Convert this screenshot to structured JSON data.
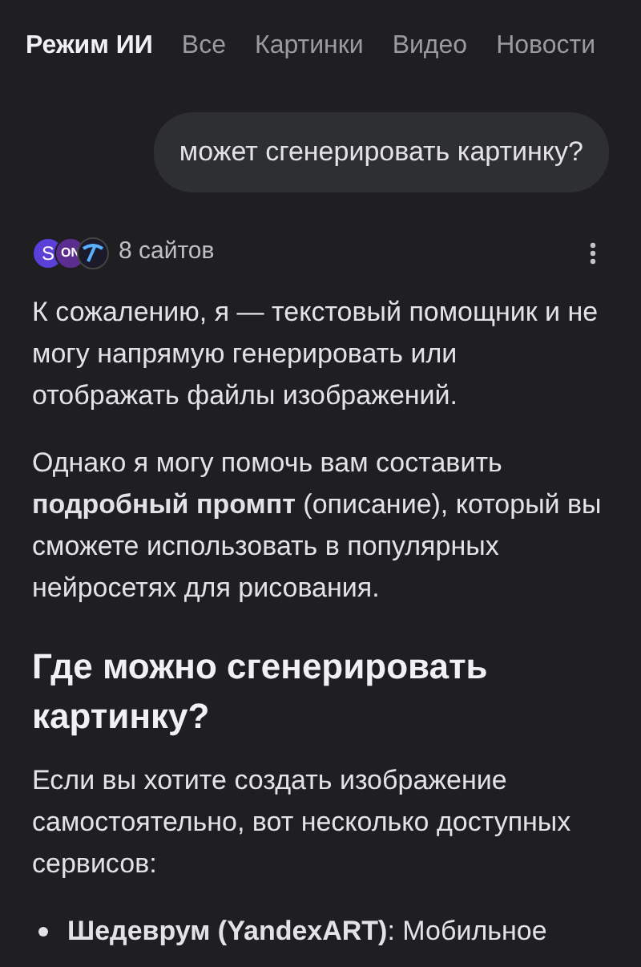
{
  "tabs": [
    {
      "label": "Режим ИИ",
      "selected": true
    },
    {
      "label": "Все",
      "selected": false
    },
    {
      "label": "Картинки",
      "selected": false
    },
    {
      "label": "Видео",
      "selected": false
    },
    {
      "label": "Новости",
      "selected": false
    }
  ],
  "query": "может сгенерировать картинку?",
  "sources": {
    "logos": [
      "S",
      "ON"
    ],
    "count": "8 сайтов"
  },
  "answer": [
    {
      "kind": "paragraph",
      "text": "К сожалению, я — текстовый помощник и не могу напрямую генерировать или отображать файлы изображений."
    },
    {
      "kind": "paragraph",
      "text": "Однако я могу помочь вам составить **подробный промпт** (описание), который вы сможете использовать в популярных нейросетях для рисования."
    },
    {
      "kind": "heading",
      "text": "Где можно сгенерировать картинку?"
    },
    {
      "kind": "paragraph",
      "text": "Если вы хотите создать изображение самостоятельно, вот несколько доступных сервисов:"
    },
    {
      "kind": "bullet",
      "text": "**Шедеврум (YandexART)**: Мобильное"
    }
  ]
}
